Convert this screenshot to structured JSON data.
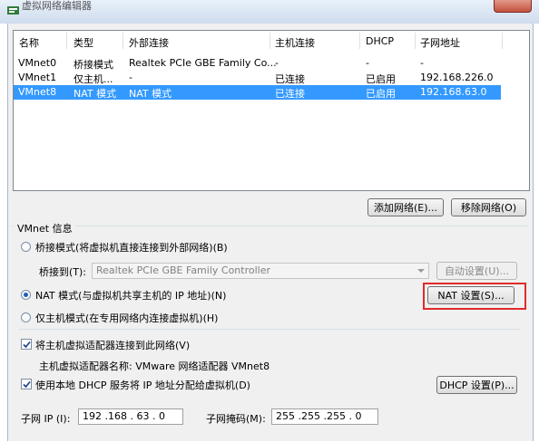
{
  "title": "虚拟网络编辑器",
  "table": {
    "headers": [
      "名称",
      "类型",
      "外部连接",
      "主机连接",
      "DHCP",
      "子网地址"
    ],
    "rows": [
      {
        "name": "VMnet0",
        "type": "桥接模式",
        "external": "Realtek PCIe GBE Family Co...",
        "host": "-",
        "dhcp": "-",
        "subnet": "-",
        "selected": false
      },
      {
        "name": "VMnet1",
        "type": "仅主机...",
        "external": "-",
        "host": "已连接",
        "dhcp": "已启用",
        "subnet": "192.168.226.0",
        "selected": false
      },
      {
        "name": "VMnet8",
        "type": "NAT 模式",
        "external": "NAT 模式",
        "host": "已连接",
        "dhcp": "已启用",
        "subnet": "192.168.63.0",
        "selected": true
      }
    ]
  },
  "buttons": {
    "add_network": "添加网络(E)...",
    "remove_network": "移除网络(O)"
  },
  "vmnet_info": {
    "group_title": "VMnet 信息",
    "bridge_mode": "桥接模式(将虚拟机直接连接到外部网络)(B)",
    "bridge_to_label": "桥接到(T):",
    "bridge_to_value": "Realtek PCIe GBE Family Controller",
    "auto_settings": "自动设置(U)...",
    "nat_mode": "NAT 模式(与虚拟机共享主机的 IP 地址)(N)",
    "nat_settings": "NAT 设置(S)...",
    "host_only": "仅主机模式(在专用网络内连接虚拟机)(H)",
    "selected_mode": "nat",
    "connect_host_adapter": "将主机虚拟适配器连接到此网络(V)",
    "connect_host_adapter_checked": true,
    "host_adapter_name": "主机虚拟适配器名称: VMware 网络适配器 VMnet8",
    "use_dhcp": "使用本地 DHCP 服务将 IP 地址分配给虚拟机(D)",
    "use_dhcp_checked": true,
    "dhcp_settings": "DHCP 设置(P)...",
    "subnet_ip_label": "子网 IP (I):",
    "subnet_ip": "192 .168 . 63 . 0",
    "subnet_mask_label": "子网掩码(M):",
    "subnet_mask": "255 .255 .255 . 0"
  },
  "colors": {
    "selection": "#3399ff",
    "highlight_box": "#e02a2a"
  }
}
